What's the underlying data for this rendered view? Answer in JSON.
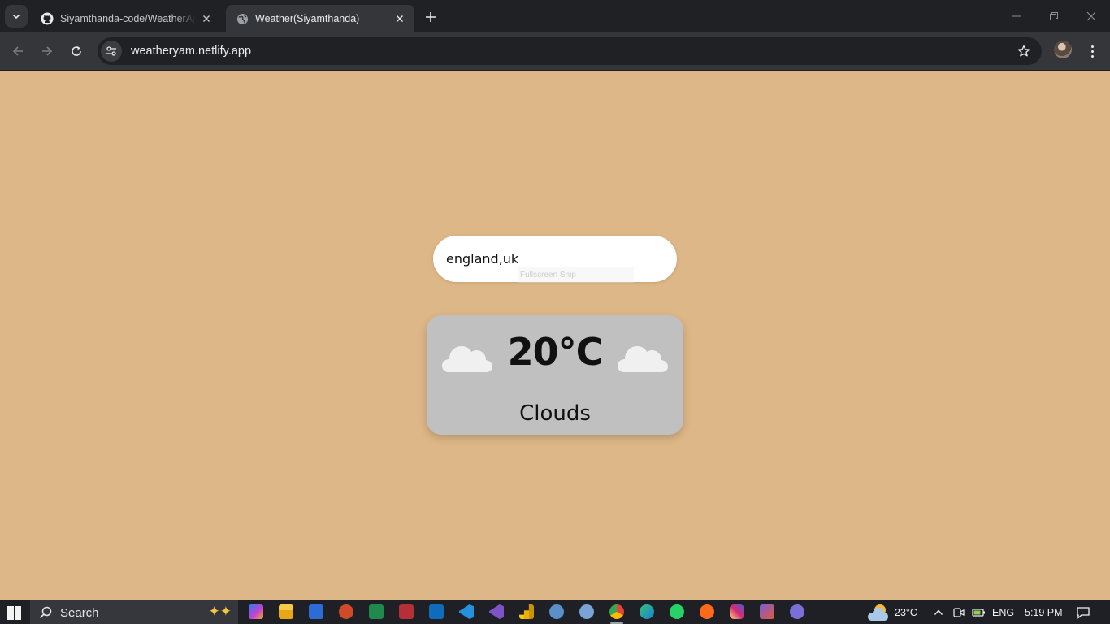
{
  "browser": {
    "tabs": [
      {
        "title": "Siyamthanda-code/WeatherApp",
        "icon": "github-icon",
        "active": false
      },
      {
        "title": "Weather(Siyamthanda)",
        "icon": "globe-icon",
        "active": true
      }
    ],
    "url": "weatheryam.netlify.app"
  },
  "page": {
    "background": "#ddb787",
    "search_value": "england,uk",
    "overlay_hint": "Fullscreen Snip",
    "weather": {
      "temperature": "20°C",
      "description": "Clouds",
      "icon": "cloud-icon"
    }
  },
  "taskbar": {
    "search_label": "Search",
    "weather_temp": "23°C",
    "language": "ENG",
    "time": "5:19 PM",
    "apps": [
      "copilot",
      "file-explorer",
      "word",
      "powerpoint",
      "excel",
      "access",
      "outlook",
      "vs-code",
      "visual-studio",
      "power-bi",
      "rstudio",
      "r",
      "chrome",
      "edge",
      "whatsapp",
      "soundcloud",
      "instagram",
      "app-check",
      "app-settings"
    ]
  }
}
